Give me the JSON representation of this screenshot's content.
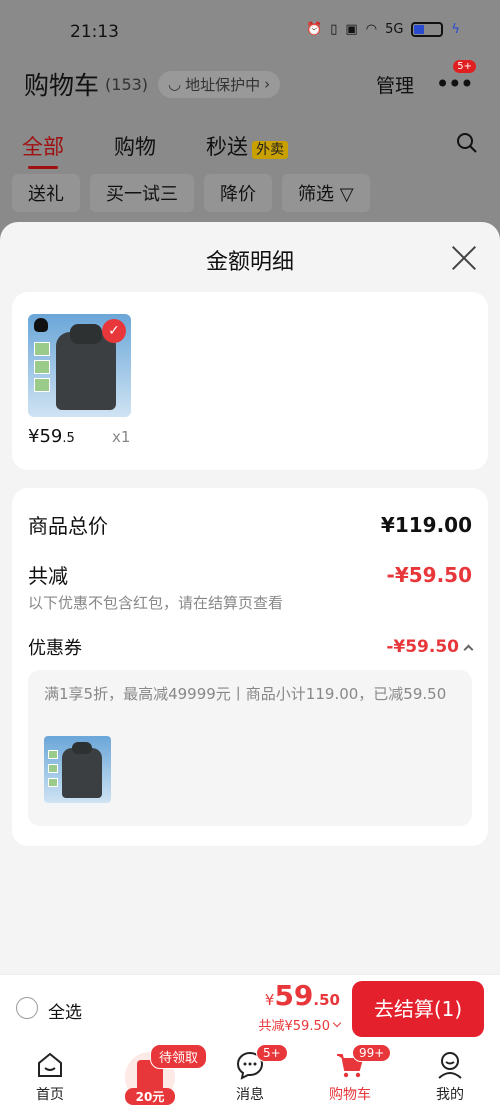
{
  "status_bar": {
    "time": "21:13",
    "network": "5G"
  },
  "header": {
    "title": "购物车",
    "count": "(153)",
    "address": "地址保护中",
    "manage": "管理",
    "more_badge": "5+"
  },
  "tabs": [
    {
      "label": "全部",
      "active": true
    },
    {
      "label": "购物",
      "active": false
    },
    {
      "label": "秒送",
      "active": false,
      "badge": "外卖"
    }
  ],
  "filters": [
    "送礼",
    "买一试三",
    "降价",
    "筛选"
  ],
  "sheet": {
    "title": "金额明细",
    "product": {
      "price_int": "¥59",
      "price_dec": ".5",
      "qty": "x1"
    },
    "summary": {
      "total_label": "商品总价",
      "total_value": "¥119.00",
      "reduce_label": "共减",
      "reduce_value": "-¥59.50",
      "reduce_note": "以下优惠不包含红包，请在结算页查看",
      "coupon_label": "优惠券",
      "coupon_value": "-¥59.50",
      "coupon_desc": "满1享5折，最高减49999元丨商品小计119.00，已减59.50"
    }
  },
  "checkout": {
    "select_all": "全选",
    "yen": "¥",
    "price_int": "59",
    "price_dec": ".50",
    "discount": "共减¥59.50",
    "button": "去结算(1)"
  },
  "nav": {
    "home": "首页",
    "redpacket_tag": "待领取",
    "redpacket_amount": "20元",
    "messages": "消息",
    "messages_badge": "5+",
    "cart": "购物车",
    "cart_badge": "99+",
    "mine": "我的"
  },
  "colors": {
    "accent": "#e8373a",
    "button": "#e4202c",
    "tab_active": "#a01010"
  }
}
